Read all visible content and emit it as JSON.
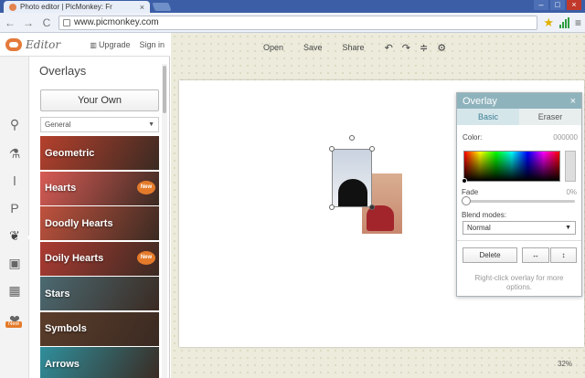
{
  "browser": {
    "tab_title": "Photo editor | PicMonkey: Fr",
    "tab_close": "×",
    "url": "www.picmonkey.com",
    "nav_back": "←",
    "nav_forward": "→",
    "reload": "C",
    "min": "–",
    "max": "□",
    "close": "×",
    "star": "★",
    "menu": "≡"
  },
  "editor": {
    "logo_text": "Editor",
    "upgrade_label": "Upgrade",
    "signin_label": "Sign in"
  },
  "panel": {
    "title": "Overlays",
    "own_button": "Your Own",
    "category_select": "General",
    "categories": [
      {
        "label": "Geometric",
        "badge": "",
        "color": "#b5402d"
      },
      {
        "label": "Hearts",
        "badge": "New",
        "color": "#d85b55"
      },
      {
        "label": "Doodly Hearts",
        "badge": "",
        "color": "#c0523e"
      },
      {
        "label": "Doily Hearts",
        "badge": "New",
        "color": "#ad3b32"
      },
      {
        "label": "Stars",
        "badge": "",
        "color": "#4b6a72"
      },
      {
        "label": "Symbols",
        "badge": "",
        "color": "#5b3d2a"
      },
      {
        "label": "Arrows",
        "badge": "",
        "color": "#2f8f9c"
      }
    ]
  },
  "tools": {
    "new_badge": "New"
  },
  "actions": {
    "open": "Open",
    "save": "Save",
    "share": "Share"
  },
  "overlay_panel": {
    "title": "Overlay",
    "close": "×",
    "tab_basic": "Basic",
    "tab_eraser": "Eraser",
    "color_label": "Color:",
    "color_value": "000000",
    "fade_label": "Fade",
    "fade_value": "0%",
    "blend_label": "Blend modes:",
    "blend_value": "Normal",
    "delete_label": "Delete",
    "flip_h": "↔",
    "flip_v": "↕",
    "hint": "Right-click overlay for more options."
  },
  "zoom": "32%",
  "colors": {
    "accent": "#e47b2b",
    "overlay_header": "#8fb3bd",
    "workspace_bg": "#ecebdc"
  }
}
